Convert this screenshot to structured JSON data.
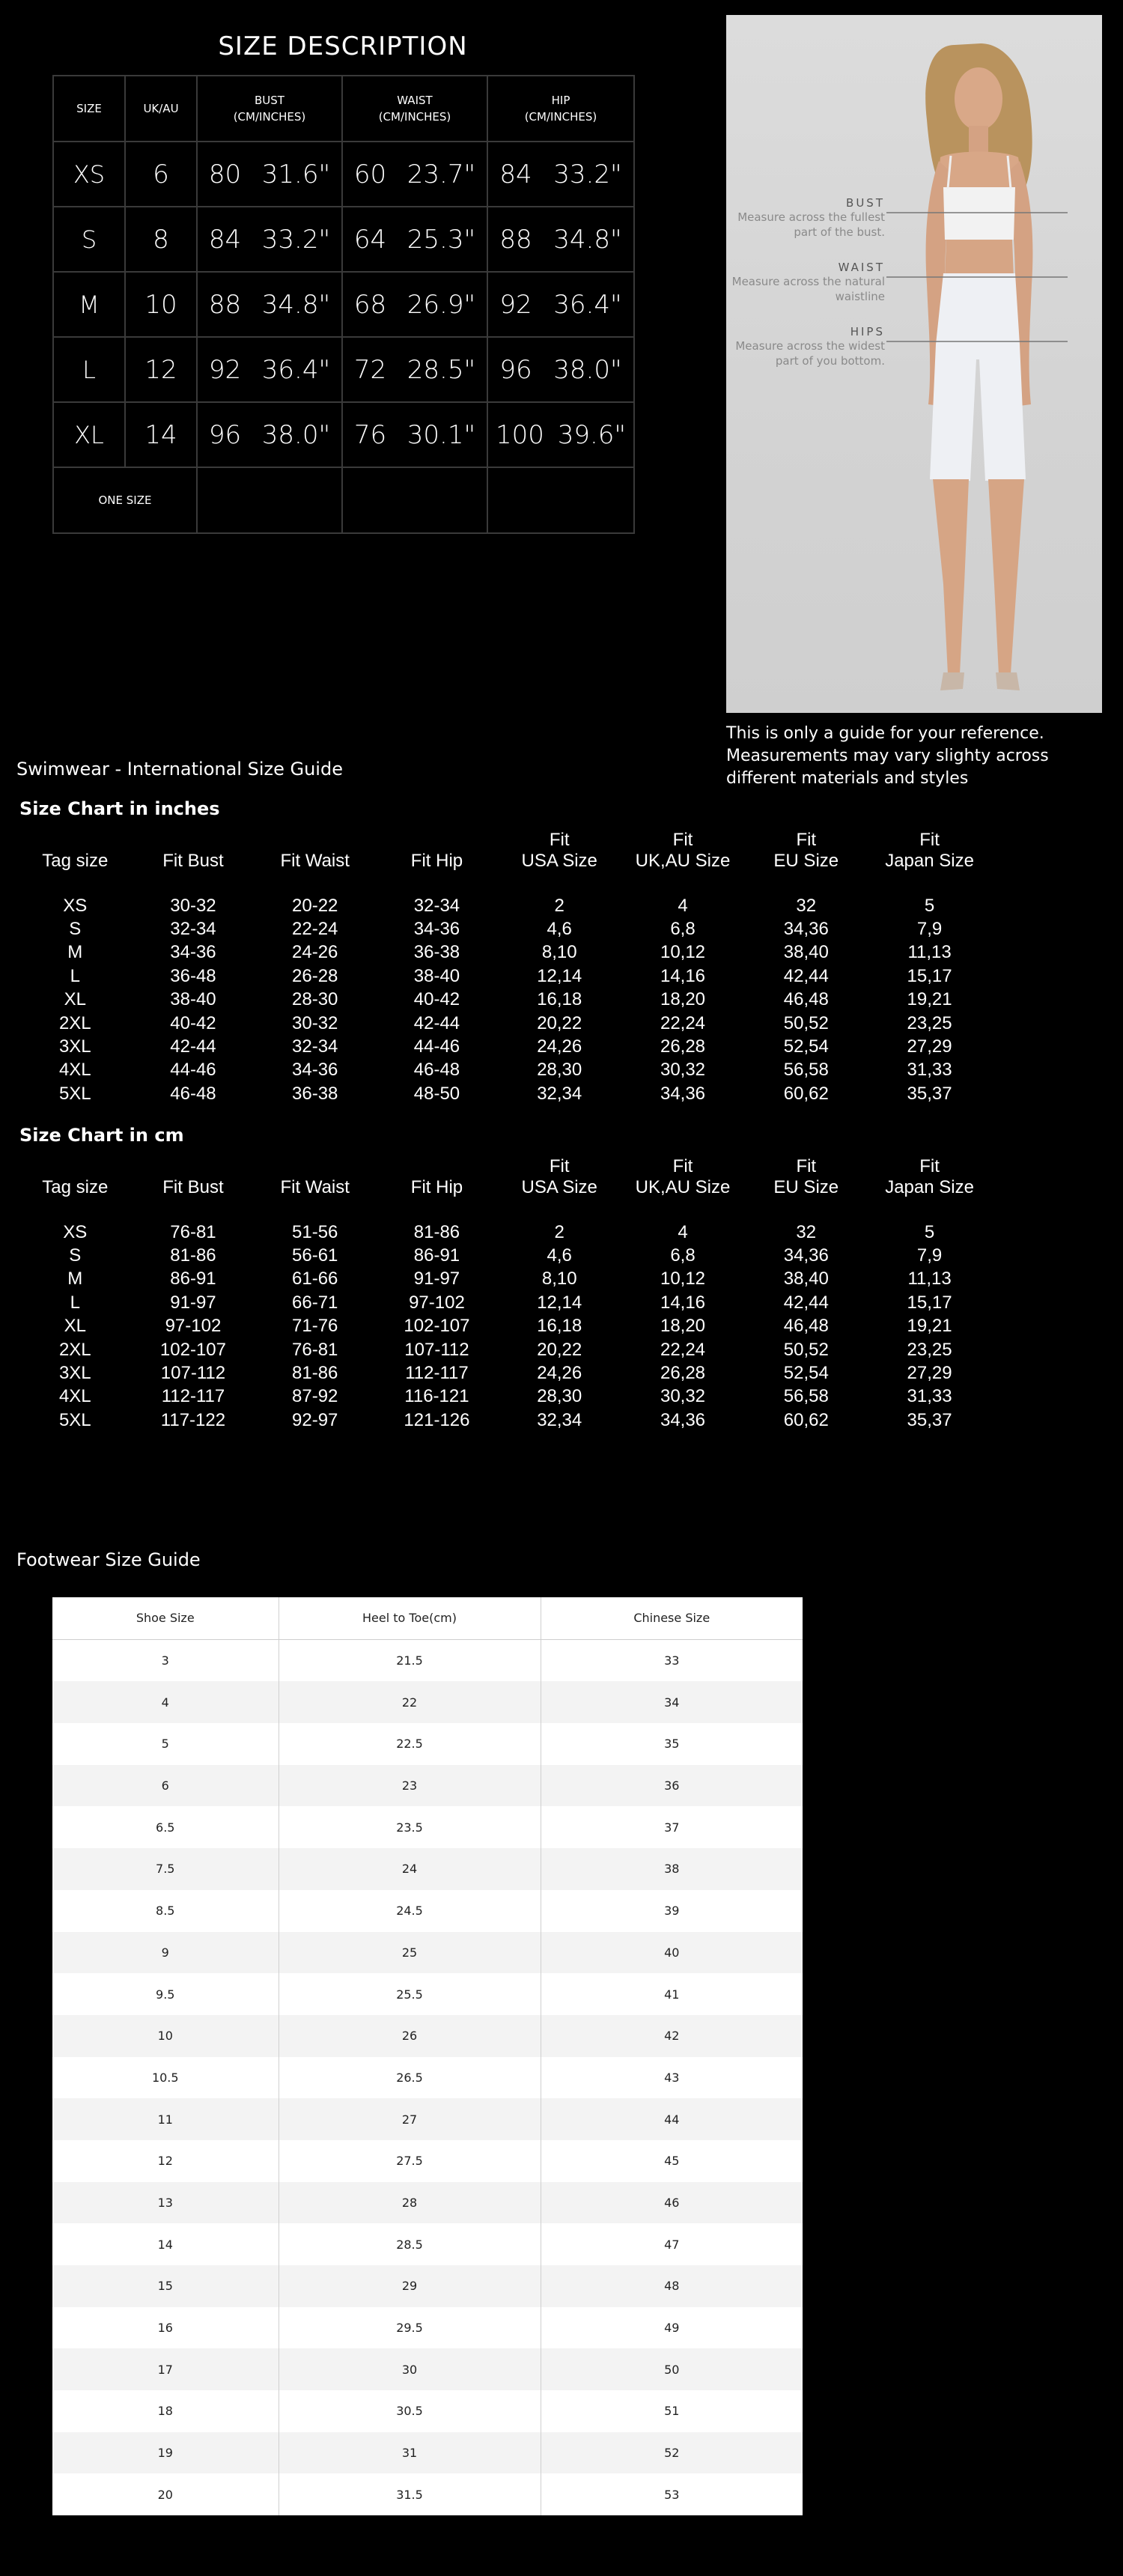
{
  "size_description": {
    "title": "SIZE DESCRIPTION",
    "headers": {
      "size": "SIZE",
      "ukau": "UK/AU",
      "bust": "BUST",
      "waist": "WAIST",
      "hip": "HIP",
      "unit": "(CM/INCHES)"
    },
    "rows": [
      {
        "size": "XS",
        "ukau": "6",
        "bust_cm": "80",
        "bust_in": "31.6\"",
        "waist_cm": "60",
        "waist_in": "23.7\"",
        "hip_cm": "84",
        "hip_in": "33.2\""
      },
      {
        "size": "S",
        "ukau": "8",
        "bust_cm": "84",
        "bust_in": "33.2\"",
        "waist_cm": "64",
        "waist_in": "25.3\"",
        "hip_cm": "88",
        "hip_in": "34.8\""
      },
      {
        "size": "M",
        "ukau": "10",
        "bust_cm": "88",
        "bust_in": "34.8\"",
        "waist_cm": "68",
        "waist_in": "26.9\"",
        "hip_cm": "92",
        "hip_in": "36.4\""
      },
      {
        "size": "L",
        "ukau": "12",
        "bust_cm": "92",
        "bust_in": "36.4\"",
        "waist_cm": "72",
        "waist_in": "28.5\"",
        "hip_cm": "96",
        "hip_in": "38.0\""
      },
      {
        "size": "XL",
        "ukau": "14",
        "bust_cm": "96",
        "bust_in": "38.0\"",
        "waist_cm": "76",
        "waist_in": "30.1\"",
        "hip_cm": "100",
        "hip_in": "39.6\""
      }
    ],
    "one_size": "ONE SIZE"
  },
  "measure_guide": {
    "bust": {
      "heading": "BUST",
      "lines": [
        "Measure across the fullest",
        "part of the bust."
      ]
    },
    "waist": {
      "heading": "WAIST",
      "lines": [
        "Measure across the natural",
        "waistline"
      ]
    },
    "hips": {
      "heading": "HIPS",
      "lines": [
        "Measure across the widest",
        "part of you bottom."
      ]
    },
    "note": "This is only a guide for your reference. Measurements may vary slighty across different materials and styles"
  },
  "swimwear": {
    "title": "Swimwear - International Size Guide",
    "fit_label": "Fit",
    "headers": [
      "Tag size",
      "Fit Bust",
      "Fit Waist",
      "Fit Hip",
      "USA Size",
      "UK,AU Size",
      "EU Size",
      "Japan Size"
    ],
    "inches": {
      "title": "Size Chart in inches",
      "rows": [
        [
          "XS",
          "30-32",
          "20-22",
          "32-34",
          "2",
          "4",
          "32",
          "5"
        ],
        [
          "S",
          "32-34",
          "22-24",
          "34-36",
          "4,6",
          "6,8",
          "34,36",
          "7,9"
        ],
        [
          "M",
          "34-36",
          "24-26",
          "36-38",
          "8,10",
          "10,12",
          "38,40",
          "11,13"
        ],
        [
          "L",
          "36-48",
          "26-28",
          "38-40",
          "12,14",
          "14,16",
          "42,44",
          "15,17"
        ],
        [
          "XL",
          "38-40",
          "28-30",
          "40-42",
          "16,18",
          "18,20",
          "46,48",
          "19,21"
        ],
        [
          "2XL",
          "40-42",
          "30-32",
          "42-44",
          "20,22",
          "22,24",
          "50,52",
          "23,25"
        ],
        [
          "3XL",
          "42-44",
          "32-34",
          "44-46",
          "24,26",
          "26,28",
          "52,54",
          "27,29"
        ],
        [
          "4XL",
          "44-46",
          "34-36",
          "46-48",
          "28,30",
          "30,32",
          "56,58",
          "31,33"
        ],
        [
          "5XL",
          "46-48",
          "36-38",
          "48-50",
          "32,34",
          "34,36",
          "60,62",
          "35,37"
        ]
      ]
    },
    "cm": {
      "title": "Size Chart in cm",
      "rows": [
        [
          "XS",
          "76-81",
          "51-56",
          "81-86",
          "2",
          "4",
          "32",
          "5"
        ],
        [
          "S",
          "81-86",
          "56-61",
          "86-91",
          "4,6",
          "6,8",
          "34,36",
          "7,9"
        ],
        [
          "M",
          "86-91",
          "61-66",
          "91-97",
          "8,10",
          "10,12",
          "38,40",
          "11,13"
        ],
        [
          "L",
          "91-97",
          "66-71",
          "97-102",
          "12,14",
          "14,16",
          "42,44",
          "15,17"
        ],
        [
          "XL",
          "97-102",
          "71-76",
          "102-107",
          "16,18",
          "18,20",
          "46,48",
          "19,21"
        ],
        [
          "2XL",
          "102-107",
          "76-81",
          "107-112",
          "20,22",
          "22,24",
          "50,52",
          "23,25"
        ],
        [
          "3XL",
          "107-112",
          "81-86",
          "112-117",
          "24,26",
          "26,28",
          "52,54",
          "27,29"
        ],
        [
          "4XL",
          "112-117",
          "87-92",
          "116-121",
          "28,30",
          "30,32",
          "56,58",
          "31,33"
        ],
        [
          "5XL",
          "117-122",
          "92-97",
          "121-126",
          "32,34",
          "34,36",
          "60,62",
          "35,37"
        ]
      ]
    }
  },
  "footwear": {
    "title": "Footwear Size Guide",
    "headers": [
      "Shoe Size",
      "Heel to Toe(cm)",
      "Chinese Size"
    ],
    "rows": [
      [
        "3",
        "21.5",
        "33"
      ],
      [
        "4",
        "22",
        "34"
      ],
      [
        "5",
        "22.5",
        "35"
      ],
      [
        "6",
        "23",
        "36"
      ],
      [
        "6.5",
        "23.5",
        "37"
      ],
      [
        "7.5",
        "24",
        "38"
      ],
      [
        "8.5",
        "24.5",
        "39"
      ],
      [
        "9",
        "25",
        "40"
      ],
      [
        "9.5",
        "25.5",
        "41"
      ],
      [
        "10",
        "26",
        "42"
      ],
      [
        "10.5",
        "26.5",
        "43"
      ],
      [
        "11",
        "27",
        "44"
      ],
      [
        "12",
        "27.5",
        "45"
      ],
      [
        "13",
        "28",
        "46"
      ],
      [
        "14",
        "28.5",
        "47"
      ],
      [
        "15",
        "29",
        "48"
      ],
      [
        "16",
        "29.5",
        "49"
      ],
      [
        "17",
        "30",
        "50"
      ],
      [
        "18",
        "30.5",
        "51"
      ],
      [
        "19",
        "31",
        "52"
      ],
      [
        "20",
        "31.5",
        "53"
      ]
    ]
  }
}
